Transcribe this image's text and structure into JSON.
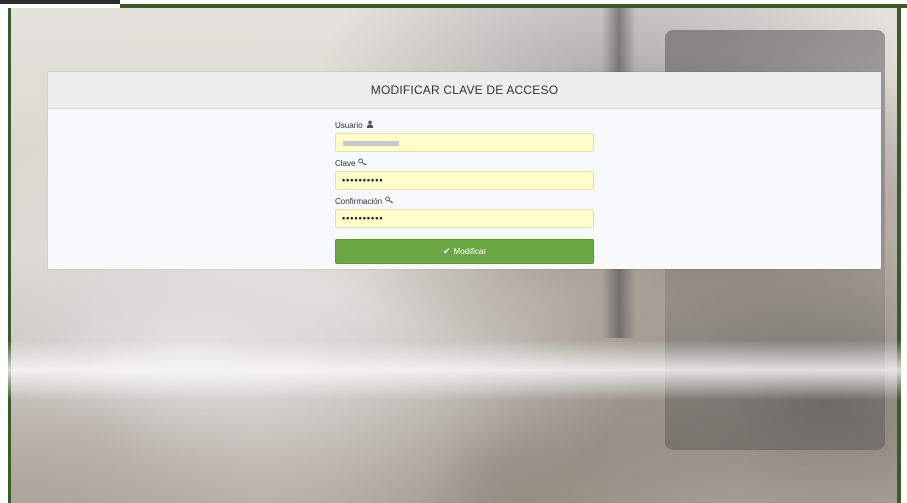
{
  "panel": {
    "title": "MODIFICAR CLAVE DE ACCESO"
  },
  "form": {
    "usuario": {
      "label": "Usuario",
      "icon": "user-icon",
      "value": ""
    },
    "clave": {
      "label": "Clave",
      "icon": "key-icon",
      "value": "••••••••••"
    },
    "confirmacion": {
      "label": "Confirmación",
      "icon": "key-icon",
      "value": "••••••••••"
    },
    "submit": {
      "label": "Modificar",
      "icon": "check-icon",
      "color": "#6ba742"
    }
  },
  "colors": {
    "input_background": "#fefecb",
    "header_background": "#eeeeee",
    "frame_accent": "#3c5a2a"
  }
}
